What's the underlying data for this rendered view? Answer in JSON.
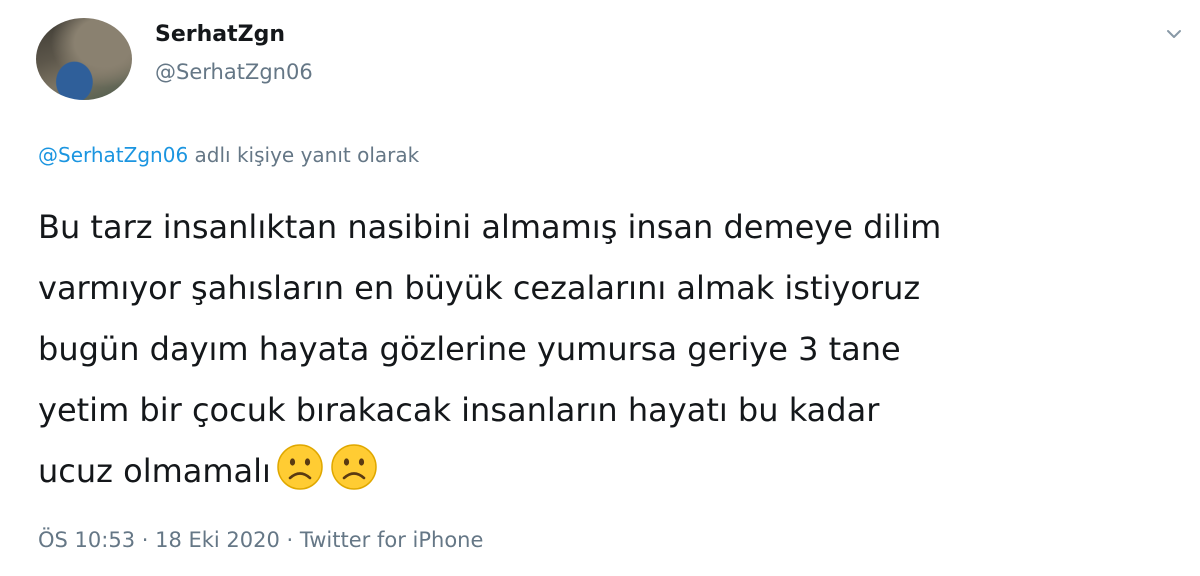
{
  "user": {
    "display_name": "SerhatZgn",
    "handle": "@SerhatZgn06"
  },
  "reply": {
    "mention": "@SerhatZgn06",
    "suffix": " adlı kişiye yanıt olarak"
  },
  "tweet": {
    "lines": [
      "Bu tarz insanlıktan nasibini almamış insan demeye dilim",
      "varmıyor şahısların en büyük cezalarını almak istiyoruz",
      "bugün dayım hayata gözlerine yumursa geriye 3 tane",
      "yetim bir çocuk bırakacak insanların hayatı bu kadar",
      "ucuz olmamalı"
    ],
    "emojis": [
      "frowning-face",
      "frowning-face"
    ]
  },
  "meta": {
    "time": "ÖS 10:53",
    "separator1": " · ",
    "date": "18 Eki 2020",
    "separator2": " · ",
    "source": "Twitter for iPhone"
  },
  "icons": {
    "menu_caret": "chevron-down-icon"
  },
  "colors": {
    "link": "#1b95e0",
    "secondary_text": "#657786",
    "primary_text": "#14171a",
    "emoji_fill": "#ffcc33"
  }
}
